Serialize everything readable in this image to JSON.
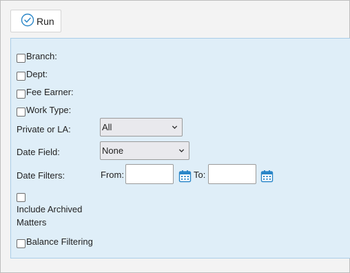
{
  "toolbar": {
    "run_label": "Run"
  },
  "filters": {
    "branch_label": "Branch:",
    "dept_label": "Dept:",
    "fee_earner_label": "Fee Earner:",
    "work_type_label": "Work Type:",
    "private_or_la_label": "Private or LA:",
    "private_or_la_value": "All",
    "date_field_label": "Date Field:",
    "date_field_value": "None",
    "date_filters_label": "Date Filters:",
    "from_label": "From:",
    "to_label": "To:",
    "include_archived_line1": "Include Archived",
    "include_archived_line2": "Matters",
    "balance_filtering_label": "Balance Filtering"
  },
  "icons": {
    "run": "check-circle-icon",
    "select": "chevron-down-icon",
    "date_picker": "calendar-icon"
  },
  "colors": {
    "panel_bg": "#dfeef8",
    "panel_border": "#a9cde8",
    "accent": "#2a86c8"
  }
}
